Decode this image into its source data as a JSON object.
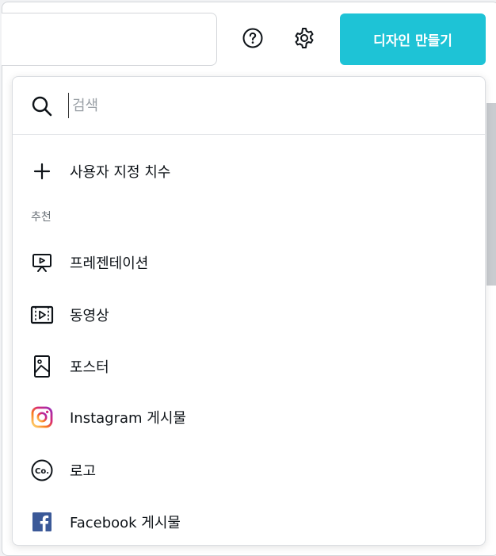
{
  "header": {
    "create_button_label": "디자인 만들기",
    "help_icon": "help-circle-icon",
    "settings_icon": "gear-icon"
  },
  "dropdown": {
    "search": {
      "placeholder": "검색",
      "value": ""
    },
    "custom_size_label": "사용자 지정 치수",
    "section_title": "추천",
    "items": [
      {
        "label": "프레젠테이션",
        "icon": "presentation-icon"
      },
      {
        "label": "동영상",
        "icon": "video-icon"
      },
      {
        "label": "포스터",
        "icon": "poster-icon"
      },
      {
        "label": "Instagram 게시물",
        "icon": "instagram-icon"
      },
      {
        "label": "로고",
        "icon": "logo-icon"
      },
      {
        "label": "Facebook 게시물",
        "icon": "facebook-icon"
      }
    ]
  },
  "colors": {
    "accent": "#1ec3d6",
    "instagram_gradient": [
      "#feda75",
      "#d62976",
      "#962fbf"
    ],
    "facebook": "#3b5998"
  }
}
